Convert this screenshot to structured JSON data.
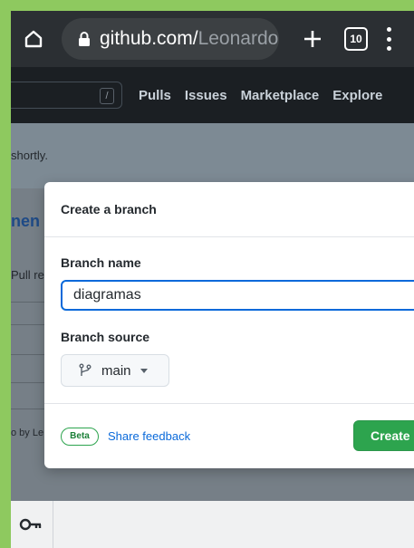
{
  "browser": {
    "url_host": "github.com/",
    "url_path": "Leonardo",
    "tab_count": "10"
  },
  "gh_header": {
    "slash_key": "/",
    "nav": [
      {
        "label": "Pulls"
      },
      {
        "label": "Issues"
      },
      {
        "label": "Marketplace"
      },
      {
        "label": "Explore"
      }
    ]
  },
  "background": {
    "flash_text": "shortly.",
    "page_title_fragment": "nen",
    "sub_fragment": "Pull re",
    "credit_fragment": "o by Le"
  },
  "modal": {
    "title": "Create a branch",
    "branch_name_label": "Branch name",
    "branch_name_value": "diagramas",
    "branch_source_label": "Branch source",
    "branch_source_value": "main",
    "beta_label": "Beta",
    "feedback_label": "Share feedback",
    "create_label": "Create"
  },
  "colors": {
    "primary_green": "#2da44e",
    "link_blue": "#0969da",
    "header_dark": "#1b1f23"
  }
}
